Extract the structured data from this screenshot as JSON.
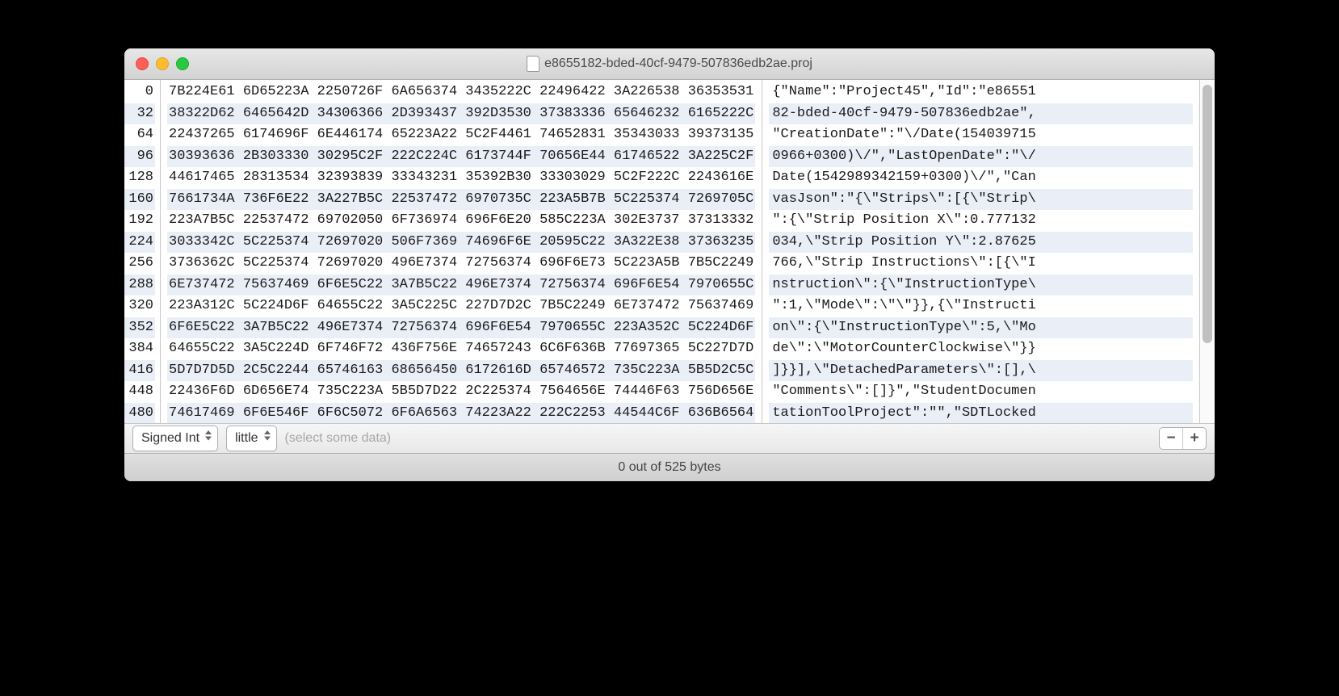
{
  "window": {
    "title": "e8655182-bded-40cf-9479-507836edb2ae.proj"
  },
  "offsets": [
    "0",
    "32",
    "64",
    "96",
    "128",
    "160",
    "192",
    "224",
    "256",
    "288",
    "320",
    "352",
    "384",
    "416",
    "448",
    "480"
  ],
  "hex_rows": [
    "7B224E61 6D65223A 2250726F 6A656374 3435222C 22496422 3A226538 36353531",
    "38322D62 6465642D 34306366 2D393437 392D3530 37383336 65646232 6165222C",
    "22437265 6174696F 6E446174 65223A22 5C2F4461 74652831 35343033 39373135",
    "30393636 2B303330 30295C2F 222C224C 6173744F 70656E44 61746522 3A225C2F",
    "44617465 28313534 32393839 33343231 35392B30 33303029 5C2F222C 2243616E",
    "7661734A 736F6E22 3A227B5C 22537472 6970735C 223A5B7B 5C225374 7269705C",
    "223A7B5C 22537472 69702050 6F736974 696F6E20 585C223A 302E3737 37313332",
    "3033342C 5C225374 72697020 506F7369 74696F6E 20595C22 3A322E38 37363235",
    "3736362C 5C225374 72697020 496E7374 72756374 696F6E73 5C223A5B 7B5C2249",
    "6E737472 75637469 6F6E5C22 3A7B5C22 496E7374 72756374 696F6E54 7970655C",
    "223A312C 5C224D6F 64655C22 3A5C225C 227D7D2C 7B5C2249 6E737472 75637469",
    "6F6E5C22 3A7B5C22 496E7374 72756374 696F6E54 7970655C 223A352C 5C224D6F",
    "64655C22 3A5C224D 6F746F72 436F756E 74657243 6C6F636B 77697365 5C227D7D",
    "5D7D7D5D 2C5C2244 65746163 68656450 6172616D 65746572 735C223A 5B5D2C5C",
    "22436F6D 6D656E74 735C223A 5B5D7D22 2C225374 7564656E 74446F63 756D656E",
    "74617469 6F6E546F 6F6C5072 6F6A6563 74223A22 222C2253 44544C6F 636B6564"
  ],
  "ascii_rows": [
    "{\"Name\":\"Project45\",\"Id\":\"e86551",
    "82-bded-40cf-9479-507836edb2ae\",",
    "\"CreationDate\":\"\\/Date(154039715",
    "0966+0300)\\/\",\"LastOpenDate\":\"\\/",
    "Date(1542989342159+0300)\\/\",\"Can",
    "vasJson\":\"{\\\"Strips\\\":[{\\\"Strip\\",
    "\":{\\\"Strip Position X\\\":0.777132",
    "034,\\\"Strip Position Y\\\":2.87625",
    "766,\\\"Strip Instructions\\\":[{\\\"I",
    "nstruction\\\":{\\\"InstructionType\\",
    "\":1,\\\"Mode\\\":\\\"\\\"}},{\\\"Instructi",
    "on\\\":{\\\"InstructionType\\\":5,\\\"Mo",
    "de\\\":\\\"MotorCounterClockwise\\\"}}",
    "]}}],\\\"DetachedParameters\\\":[],\\",
    "\"Comments\\\":[]}\",\"StudentDocumen",
    "tationToolProject\":\"\",\"SDTLocked"
  ],
  "bottom": {
    "datatype_select": "Signed Int",
    "endian_select": "little",
    "placeholder": "(select some data)",
    "minus_label": "−",
    "plus_label": "+"
  },
  "status": {
    "text": "0 out of 525 bytes"
  }
}
